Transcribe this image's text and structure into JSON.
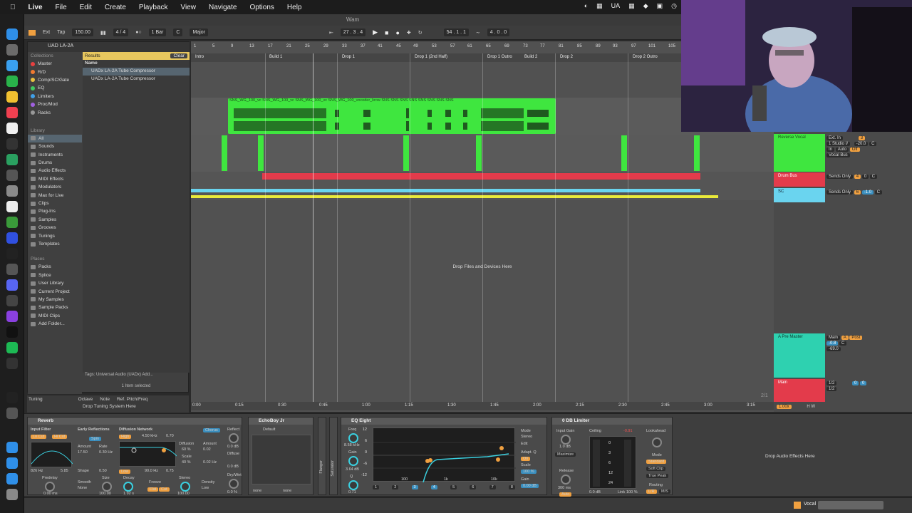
{
  "menubar": {
    "app": "Live",
    "items": [
      "File",
      "Edit",
      "Create",
      "Playback",
      "View",
      "Navigate",
      "Options",
      "Help"
    ],
    "right": "UA"
  },
  "window": {
    "title": "Wam"
  },
  "transport": {
    "ext": "Ext",
    "tap": "Tap",
    "tempo": "150.00",
    "signature": "4 / 4",
    "quantize": "1 Bar",
    "key": "C",
    "scale": "Major",
    "position": "27 .  3 .  4",
    "loop_start": "54 .  1 .  1",
    "loop_length": "4 .  0 .  0"
  },
  "browser": {
    "search": "UAD LA-2A",
    "collections_title": "Collections",
    "collections": [
      {
        "label": "Master",
        "color": "#e84040"
      },
      {
        "label": "R/D",
        "color": "#f07a30"
      },
      {
        "label": "Comp/SC/Gate",
        "color": "#e8c040"
      },
      {
        "label": "EQ",
        "color": "#40c860"
      },
      {
        "label": "Limiters",
        "color": "#40a0e8"
      },
      {
        "label": "Proc/Mod",
        "color": "#a060e0"
      },
      {
        "label": "Racks",
        "color": "#999999"
      }
    ],
    "library_title": "Library",
    "library": [
      "All",
      "Sounds",
      "Instruments",
      "Drums",
      "Audio Effects",
      "MIDI Effects",
      "Modulators",
      "Max for Live",
      "Clips",
      "Plug-Ins",
      "Samples",
      "Grooves",
      "Tunings",
      "Templates"
    ],
    "places_title": "Places",
    "places": [
      "Packs",
      "Splice",
      "User Library",
      "Current Project",
      "My Samples",
      "Sample Packs",
      "MIDI Clips",
      "Add Folder..."
    ],
    "results_label": "Results",
    "clear_label": "Clear",
    "name_header": "Name",
    "results": [
      "UADx LA-2A Tube Compressor",
      "UADx LA-2A Tube Compressor"
    ],
    "tags": "Tags:  Universal Audio (UADx)    Add...",
    "selected_count": "1 Item selected"
  },
  "tuning": {
    "label": "Tuning",
    "octave": "Octave",
    "note": "Note",
    "ref": "Ref. Pitch/Freq",
    "drop": "Drop Tuning System Here"
  },
  "arrangement": {
    "bars": [
      "1",
      "5",
      "9",
      "13",
      "17",
      "21",
      "25",
      "29",
      "33",
      "37",
      "41",
      "45",
      "49",
      "53",
      "57",
      "61",
      "65",
      "69",
      "73",
      "77",
      "81",
      "85",
      "89",
      "93",
      "97",
      "101",
      "105"
    ],
    "locators": [
      {
        "label": "Intro"
      },
      {
        "label": "Build 1"
      },
      {
        "label": "Drop 1"
      },
      {
        "label": "Drop 1 (2nd Half)"
      },
      {
        "label": "Drop 1 Outro"
      },
      {
        "label": "Build 2"
      },
      {
        "label": "Drop 2"
      },
      {
        "label": "Drop 2 Outro"
      }
    ],
    "audio_clip_header": "SNS_WG_100_vc SNS_WG_100_vc SNS_WG_100_vc SNS_WG_100_vocoder_krow SNS SNS SNS SNS SNS SNS SNS SNS",
    "drop_label": "Drop Files and Devices Here",
    "times": [
      "0:00",
      "0:15",
      "0:30",
      "0:45",
      "1:00",
      "1:15",
      "1:30",
      "1:45",
      "2:00",
      "2:15",
      "2:30",
      "2:45",
      "3:00",
      "3:15"
    ],
    "page": "2/1"
  },
  "mixer": {
    "tracks": [
      {
        "name": "Reverse Vocal",
        "color": "#3fe63f",
        "input": "Ext. In",
        "sub": "1 Studio I/",
        "monitor": [
          "In",
          "Auto",
          "Off"
        ],
        "output": "Vocal Bus",
        "number": "3",
        "vol": "-20.0",
        "pan": "C"
      },
      {
        "name": "Drum Bus",
        "color": "#e33b4b",
        "input": "Sends Only",
        "number": "4",
        "vol": "0",
        "pan": "C"
      },
      {
        "name": "SC",
        "color": "#6ad4ef",
        "input": "Sends Only",
        "number": "6",
        "vol": "-1.0",
        "pan": "C"
      },
      {
        "name": "A Pre Master",
        "color": "#2ed1b0",
        "input": "Main",
        "number": "A",
        "vol": "-0.8",
        "vol2": "-69.0",
        "pan": "C",
        "extra": "Post"
      },
      {
        "name": "Main",
        "color": "#e33b4b",
        "input": "1/2",
        "output": "1/2",
        "vol": "0",
        "pan": "0"
      }
    ],
    "zoom": "1.00x",
    "h": "H",
    "w": "W"
  },
  "devices": {
    "reverb": {
      "title": "Reverb",
      "input_filter": "Input Filter",
      "lo_cut": "Lo Cut",
      "hi_cut": "Hi Cut",
      "freq": "826 Hz",
      "width": "5.85",
      "early_reflections": "Early Reflections",
      "spin": "Spin",
      "amount": "Amount",
      "amount_val": "17.50",
      "rate": "Rate",
      "rate_val": "0.30 Hz",
      "shape": "Shape",
      "shape_val": "0.50",
      "diffusion_network": "Diffusion Network",
      "high": "High",
      "high_freq": "4.50 kHz",
      "high_val": "0.70",
      "low": "Low",
      "low_freq": "90.0 Hz",
      "low_val": "0.75",
      "diffusion": "Diffusion",
      "diffusion_val": "60 %",
      "scale": "Scale",
      "scale_val": "40 %",
      "chorus": "Chorus",
      "chorus_amount": "Amount",
      "chorus_amount_val": "0.02",
      "chorus_rate": "0.02 Hz",
      "reflect": "Reflect",
      "reflect_val": "0.0 dB",
      "diffuse": "Diffuse",
      "diffuse_val": "0.0 dB",
      "drywet": "Dry/Wet",
      "drywet_val": "0.0 %",
      "predelay": "Predelay",
      "predelay_val": "0.00 ms",
      "smooth": "Smooth",
      "smooth_val": "None",
      "size": "Size",
      "size_val": "100.00",
      "decay": "Decay",
      "decay_val": "1.92 s",
      "freeze": "Freeze",
      "flat": "Flat",
      "cut": "Cut",
      "stereo": "Stereo",
      "stereo_val": "100.00",
      "density": "Density",
      "density_val": "Low"
    },
    "echoboy": {
      "title": "EchoBoy Jr",
      "preset": "Default",
      "none1": "none",
      "none2": "none"
    },
    "flanger": "Flanger",
    "saturator": "Saturator",
    "eq": {
      "title": "EQ Eight",
      "freq": "Freq",
      "freq_val": "8.58 kHz",
      "gain": "Gain",
      "gain_val": "3.64 dB",
      "q": "Q",
      "q_val": "0.71",
      "mode": "Mode",
      "mode_val": "Stereo",
      "edit": "Edit",
      "adapt_q": "Adapt. Q",
      "adapt_on": "On",
      "scale": "Scale",
      "scale_val": "100 %",
      "out_gain": "Gain",
      "out_gain_val": "0.00 dB",
      "db_labels": [
        "12",
        "6",
        "0",
        "-6",
        "-12"
      ],
      "freq_labels": [
        "100",
        "1k",
        "10k"
      ],
      "bands": [
        "1",
        "2",
        "3",
        "4",
        "5",
        "6",
        "7",
        "8"
      ]
    },
    "limiter": {
      "title": "0 DB Limiter",
      "input_gain": "Input Gain",
      "input_gain_val": "1.0 dB",
      "maximize": "Maximize",
      "ceiling": "Ceiling",
      "ceiling_val": "-0.91",
      "release": "Release",
      "release_val": "300 ms",
      "auto": "Auto",
      "link": "Link",
      "link_val": "100 %",
      "out_val": "0.0 dB",
      "lookahead": "Lookahead",
      "mode": "Mode",
      "mode_val": "Standard",
      "soft_clip": "Soft Clip",
      "true_peak": "True Peak",
      "routing": "Routing",
      "lr": "L/R",
      "ms": "M/S",
      "meter_labels": [
        "0",
        "3",
        "6",
        "12",
        "24"
      ]
    },
    "drop_label": "Drop Audio Effects Here"
  },
  "status": {
    "track_name": "Vocal"
  }
}
